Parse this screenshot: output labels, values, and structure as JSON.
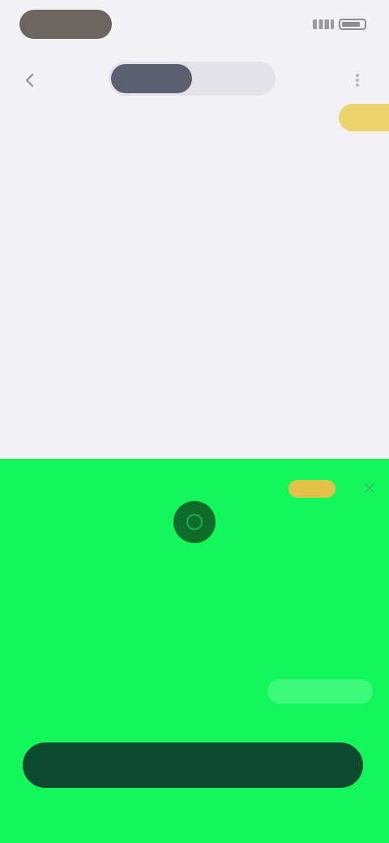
{
  "status_bar": {
    "pill_label": "",
    "icons": [
      "signal-icon",
      "battery-icon"
    ]
  },
  "nav": {
    "back_icon": "chevron-left-icon",
    "tabs": [
      {
        "label": ""
      },
      {
        "label": ""
      }
    ],
    "more_icon": "more-icon"
  },
  "article": {
    "title": "",
    "badge": "",
    "paragraphs": [
      "",
      "",
      ""
    ],
    "footer": ""
  },
  "sheet": {
    "tag": "",
    "close_icon": "close-icon",
    "icon": "app-logo-icon",
    "caption": "",
    "text": "",
    "option_label": "",
    "option_value": "",
    "button_label": ""
  },
  "colors": {
    "background": "#f1f1f6",
    "sheet_green": "#14f75a",
    "button_dark": "#0b4a30",
    "badge_yellow": "#ecd46a",
    "tab_active": "#5c5f70"
  }
}
